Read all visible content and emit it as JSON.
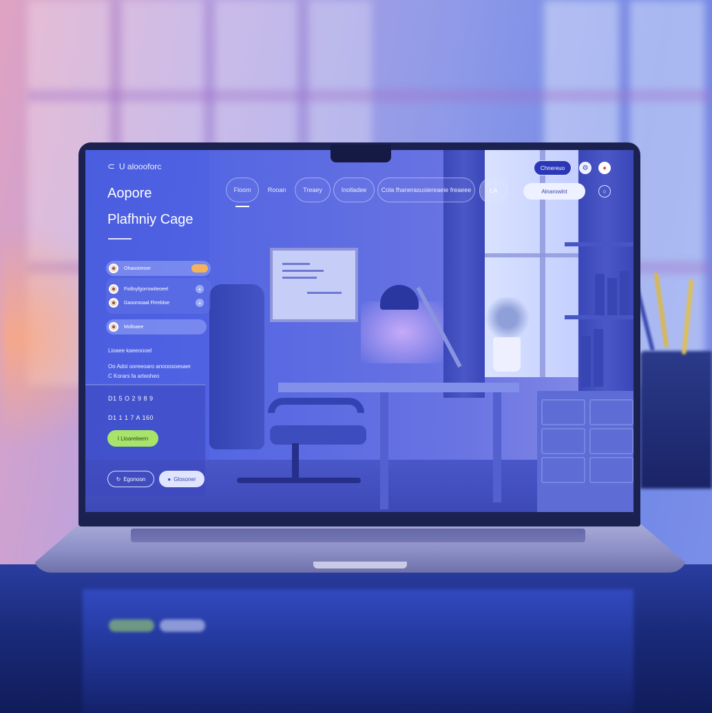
{
  "app": {
    "brand": "U aloooforc",
    "title_line1": "Aopore",
    "title_line2": "Plafhniy Cage"
  },
  "nav": {
    "tabs": [
      {
        "label": "Floom",
        "active": true
      },
      {
        "label": "Rooan",
        "active": false
      },
      {
        "label": "Treaey",
        "active": false
      },
      {
        "label": "Inolladee",
        "active": false
      },
      {
        "label": "Cola fhanerasusiereaeie freaeee",
        "active": false
      }
    ],
    "extra_tab": "LA"
  },
  "header_actions": {
    "primary_button": "Chnereuo",
    "pill_action": "Alnarowlnt",
    "icons": [
      "settings-icon",
      "notification-icon",
      "info-icon"
    ]
  },
  "sidebar": {
    "items": [
      {
        "label": "Ohaooireoer"
      },
      {
        "label": "Fiolloyfgorrowtieoeel"
      },
      {
        "label": "Gaoorooaal       Flrrebloe"
      },
      {
        "label": "Molloaee"
      }
    ],
    "text_line1": "Lioaee kaeeoooel",
    "text_line2": "Oo Adoi ooreeoaro anooosoesaer",
    "text_line3": "C Korars fa arteoheo",
    "number1": "D1 5 O 2 9 8 9",
    "number2": "D1 1 1 7 A 160",
    "green_button": "I  Lloareleern",
    "outline_button": "Egonoon",
    "light_button": "Glosoner"
  },
  "colors": {
    "accent": "#2a38b8",
    "green": "#a8e36a",
    "screen": "#5366e4"
  }
}
